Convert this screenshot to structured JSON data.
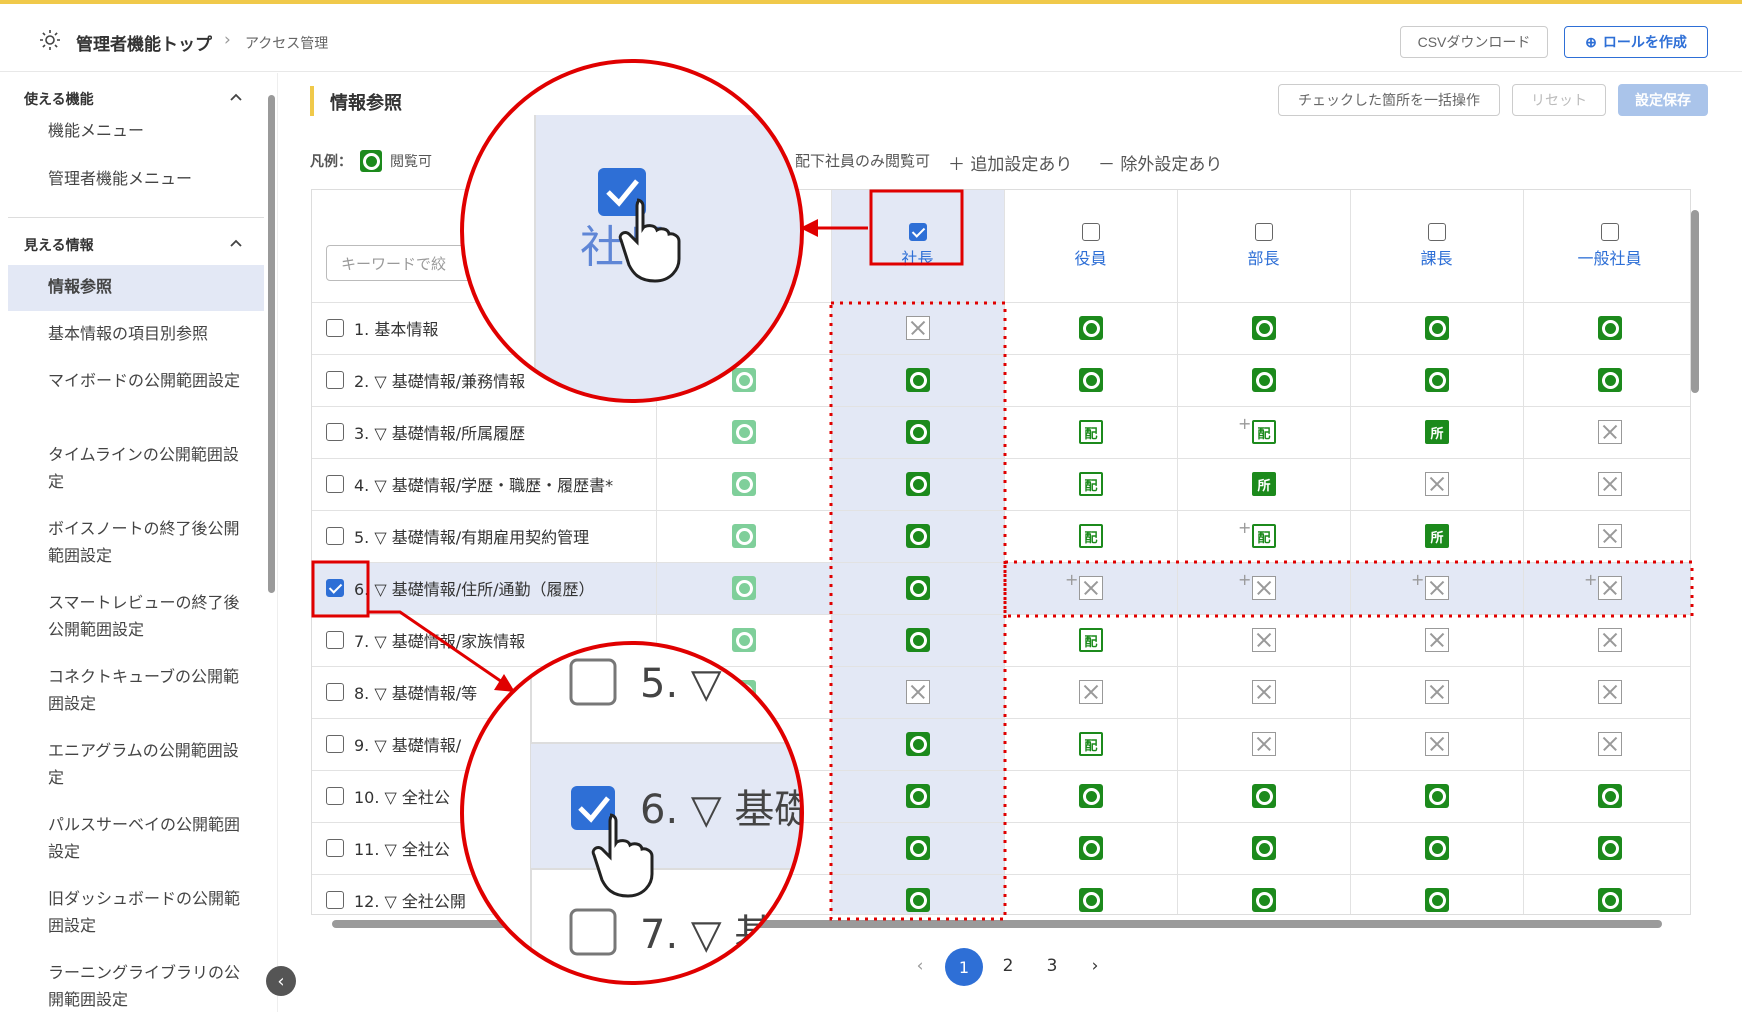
{
  "header": {
    "breadcrumb_root": "管理者機能トップ",
    "breadcrumb_current": "アクセス管理",
    "csv_button": "CSVダウンロード",
    "create_role_button": "ロールを作成"
  },
  "sidebar": {
    "section1": "使える機能",
    "section1_items": [
      "機能メニュー",
      "管理者機能メニュー"
    ],
    "section2": "見える情報",
    "section2_items": [
      "情報参照",
      "基本情報の項目別参照",
      "マイボードの公開範囲設定",
      "タイムラインの公開範囲設定",
      "ボイスノートの終了後公開範囲設定",
      "スマートレビューの終了後公開範囲設定",
      "コネクトキューブの公開範囲設定",
      "エニアグラムの公開範囲設定",
      "パルスサーベイの公開範囲設定",
      "旧ダッシュボードの公開範囲設定",
      "ラーニングライブラリの公開範囲設定"
    ]
  },
  "main": {
    "title": "情報参照",
    "bulk_button": "チェックした箇所を一括操作",
    "reset_button": "リセット",
    "save_button": "設定保存",
    "legend_label": "凡例：",
    "legend_items": [
      "閲覧可",
      "配下社員のみ閲覧可",
      "追加設定あり",
      "除外設定あり"
    ],
    "search_placeholder": "キーワードで絞",
    "columns": [
      "社長",
      "役員",
      "部長",
      "課長",
      "一般社員"
    ],
    "rows": [
      "1. 基本情報",
      "2. ▽ 基礎情報/兼務情報",
      "3. ▽ 基礎情報/所属履歴",
      "4. ▽ 基礎情報/学歴・職歴・履歴書*",
      "5. ▽ 基礎情報/有期雇用契約管理",
      "6. ▽ 基礎情報/住所/通勤（履歴）",
      "7. ▽ 基礎情報/家族情報",
      "8. ▽ 基礎情報/等",
      "9. ▽ 基礎情報/",
      "10. ▽ 全社公",
      "11. ▽ 全社公",
      "12. ▽ 全社公開"
    ],
    "cell_labels": {
      "hai": "配",
      "sho": "所"
    }
  },
  "pagination": {
    "pages": [
      "1",
      "2",
      "3"
    ],
    "current": "1"
  },
  "zoom_callout_top": {
    "label": "社長"
  },
  "zoom_callout_bottom": {
    "rows": [
      "5. ▽",
      "6. ▽ 基礎",
      "7. ▽ 基"
    ]
  },
  "colors": {
    "accent": "#2e6fd6",
    "highlight": "#e3e8f5",
    "ok_green": "#1c8a1c",
    "annotation_red": "#e00000",
    "brand_yellow": "#f0c94a"
  }
}
